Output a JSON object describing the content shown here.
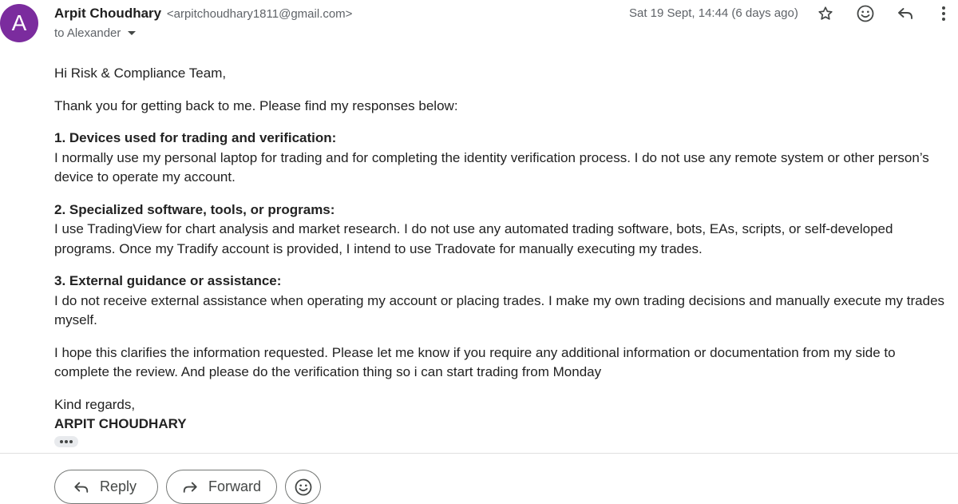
{
  "sender": {
    "avatar_letter": "A",
    "avatar_color": "#7b2c9e",
    "name": "Arpit Choudhary",
    "email": "<arpitchoudhary1811@gmail.com>",
    "to_label": "to Alexander",
    "timestamp": "Sat 19 Sept, 14:44 (6 days ago)"
  },
  "header_icons": [
    "star-icon",
    "emoji-icon",
    "reply-icon",
    "more-vert-icon"
  ],
  "body": {
    "greeting": "Hi Risk & Compliance Team,",
    "intro": "Thank you for getting back to me. Please find my responses below:",
    "sections": [
      {
        "heading": "1. Devices used for trading and verification:",
        "text": "I normally use my personal laptop for trading and for completing the identity verification process. I do not use any remote system or other person’s device to operate my account."
      },
      {
        "heading": "2. Specialized software, tools, or programs:",
        "text": "I use TradingView for chart analysis and market research. I do not use any automated trading software, bots, EAs, scripts, or self-developed programs. Once my Tradify account is provided, I intend to use Tradovate for manually executing my trades."
      },
      {
        "heading": "3. External guidance or assistance:",
        "text": "I do not receive external assistance when operating my account or placing trades. I make my own trading decisions and manually execute my trades myself."
      }
    ],
    "closing_paragraph": "I hope this clarifies the information requested. Please let me know if you require any additional information or documentation from my side to complete the review. And please do the verification thing so i can start trading from Monday",
    "signoff": "Kind regards,",
    "signature": "ARPIT CHOUDHARY"
  },
  "actions": {
    "reply_label": "Reply",
    "forward_label": "Forward"
  }
}
